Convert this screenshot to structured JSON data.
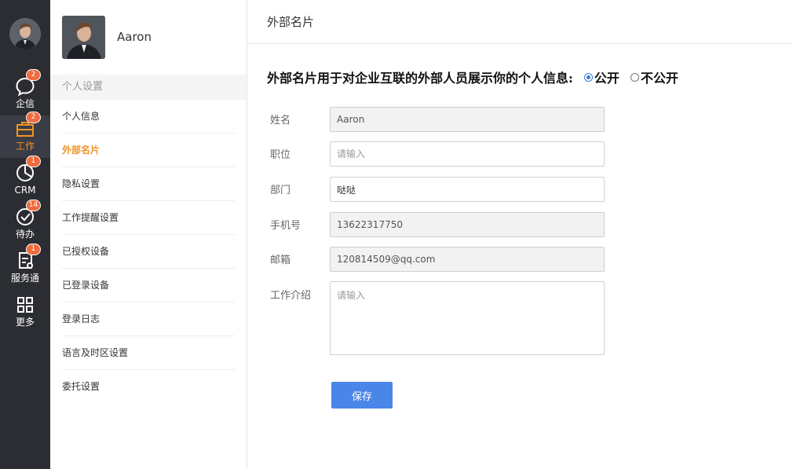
{
  "rail": {
    "items": [
      {
        "label": "企信",
        "icon": "chat-bubble-icon",
        "badge": "2"
      },
      {
        "label": "工作",
        "icon": "briefcase-icon",
        "badge": "2"
      },
      {
        "label": "CRM",
        "icon": "pie-chart-icon",
        "badge": "1"
      },
      {
        "label": "待办",
        "icon": "check-circle-icon",
        "badge": "14"
      },
      {
        "label": "服务通",
        "icon": "service-icon",
        "badge": "1"
      },
      {
        "label": "更多",
        "icon": "grid-icon",
        "badge": ""
      }
    ],
    "active_index": 1
  },
  "profile": {
    "name": "Aaron"
  },
  "settings_menu": {
    "section_title": "个人设置",
    "items": [
      {
        "label": "个人信息"
      },
      {
        "label": "外部名片"
      },
      {
        "label": "隐私设置"
      },
      {
        "label": "工作提醒设置"
      },
      {
        "label": "已授权设备"
      },
      {
        "label": "已登录设备"
      },
      {
        "label": "登录日志"
      },
      {
        "label": "语言及时区设置"
      },
      {
        "label": "委托设置"
      }
    ],
    "active_index": 1
  },
  "main": {
    "title": "外部名片",
    "notice": "外部名片用于对企业互联的外部人员展示你的个人信息:",
    "visibility_options": [
      {
        "label": "公开",
        "selected": true
      },
      {
        "label": "不公开",
        "selected": false
      }
    ],
    "fields": {
      "name": {
        "label": "姓名",
        "value": "Aaron",
        "placeholder": "",
        "disabled": true
      },
      "position": {
        "label": "职位",
        "value": "",
        "placeholder": "请输入",
        "disabled": false
      },
      "department": {
        "label": "部门",
        "value": "哒哒",
        "placeholder": "",
        "disabled": false
      },
      "phone": {
        "label": "手机号",
        "value": "13622317750",
        "placeholder": "",
        "disabled": true
      },
      "email": {
        "label": "邮箱",
        "value": "120814509@qq.com",
        "placeholder": "",
        "disabled": true
      },
      "intro": {
        "label": "工作介绍",
        "value": "",
        "placeholder": "请输入",
        "disabled": false
      }
    },
    "save_label": "保存"
  },
  "colors": {
    "rail_bg": "#2b2d33",
    "accent_orange": "#f39224",
    "badge": "#f26a3d",
    "primary_blue": "#4a86e8"
  }
}
